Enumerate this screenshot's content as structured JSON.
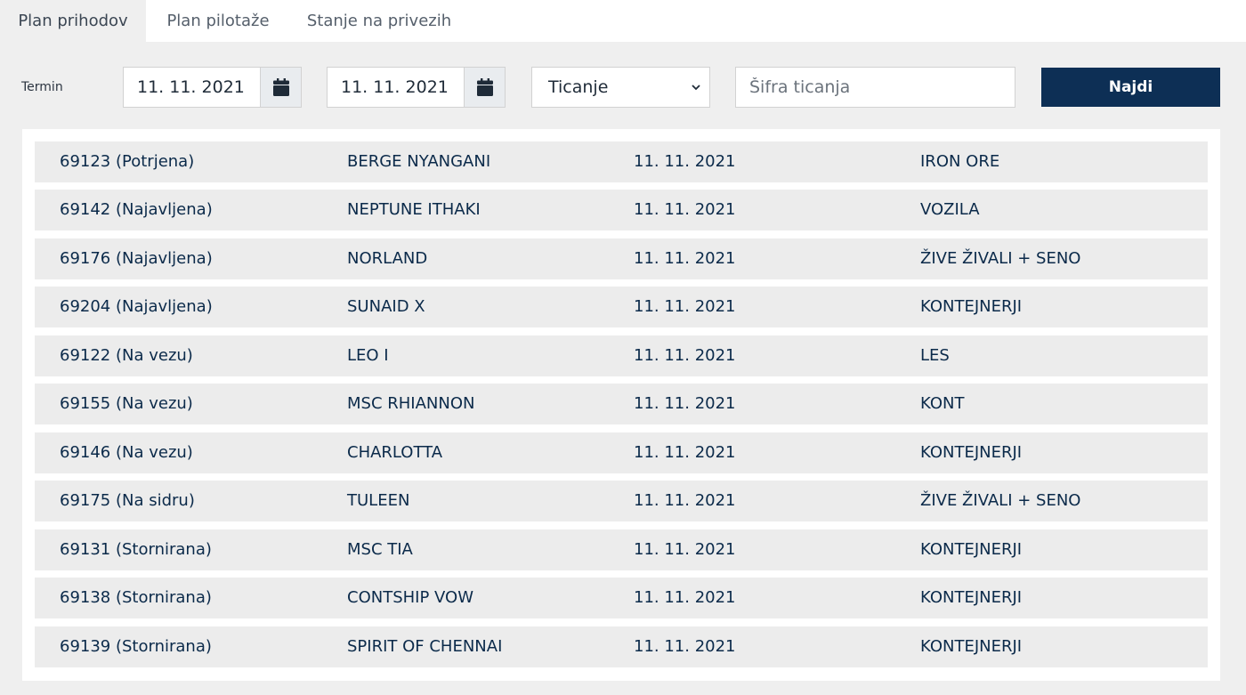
{
  "tabs": [
    {
      "label": "Plan prihodov"
    },
    {
      "label": "Plan pilotaže"
    },
    {
      "label": "Stanje na privezih"
    }
  ],
  "filter": {
    "label": "Termin",
    "date_from": "11. 11. 2021",
    "date_to": "11. 11. 2021",
    "type_selected": "Ticanje",
    "code_placeholder": "Šifra ticanja",
    "search_label": "Najdi"
  },
  "rows": [
    {
      "id": "69123 (Potrjena)",
      "ship": "BERGE NYANGANI",
      "date": "11. 11. 2021",
      "cargo": "IRON ORE"
    },
    {
      "id": "69142 (Najavljena)",
      "ship": "NEPTUNE ITHAKI",
      "date": "11. 11. 2021",
      "cargo": "VOZILA"
    },
    {
      "id": "69176 (Najavljena)",
      "ship": "NORLAND",
      "date": "11. 11. 2021",
      "cargo": "ŽIVE ŽIVALI + SENO"
    },
    {
      "id": "69204 (Najavljena)",
      "ship": "SUNAID X",
      "date": "11. 11. 2021",
      "cargo": "KONTEJNERJI"
    },
    {
      "id": "69122 (Na vezu)",
      "ship": "LEO I",
      "date": "11. 11. 2021",
      "cargo": "LES"
    },
    {
      "id": "69155 (Na vezu)",
      "ship": "MSC RHIANNON",
      "date": "11. 11. 2021",
      "cargo": "KONT"
    },
    {
      "id": "69146 (Na vezu)",
      "ship": "CHARLOTTA",
      "date": "11. 11. 2021",
      "cargo": "KONTEJNERJI"
    },
    {
      "id": "69175 (Na sidru)",
      "ship": "TULEEN",
      "date": "11. 11. 2021",
      "cargo": "ŽIVE ŽIVALI + SENO"
    },
    {
      "id": "69131 (Stornirana)",
      "ship": "MSC TIA",
      "date": "11. 11. 2021",
      "cargo": "KONTEJNERJI"
    },
    {
      "id": "69138 (Stornirana)",
      "ship": "CONTSHIP VOW",
      "date": "11. 11. 2021",
      "cargo": "KONTEJNERJI"
    },
    {
      "id": "69139 (Stornirana)",
      "ship": "SPIRIT OF CHENNAI",
      "date": "11. 11. 2021",
      "cargo": "KONTEJNERJI"
    }
  ],
  "colors": {
    "accent": "#0d2f55",
    "row_bg": "#ececec",
    "page_bg": "#efefef"
  }
}
